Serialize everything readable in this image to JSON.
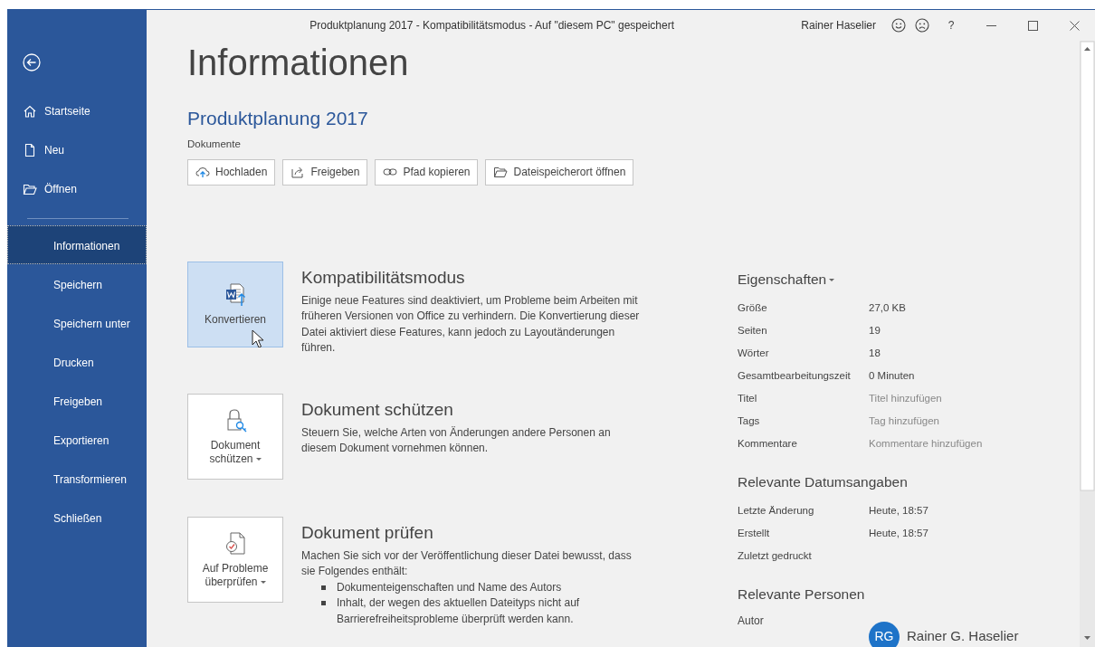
{
  "window": {
    "title": "Produktplanung 2017  -  Kompatibilitätsmodus  -  Auf \"diesem PC\" gespeichert",
    "user": "Rainer Haselier",
    "help": "?"
  },
  "sidebar": {
    "primary_items": [
      {
        "label": "Startseite",
        "selected": false
      },
      {
        "label": "Neu",
        "selected": false
      },
      {
        "label": "Öffnen",
        "selected": false
      }
    ],
    "items": [
      {
        "label": "Informationen",
        "selected": true
      },
      {
        "label": "Speichern",
        "selected": false
      },
      {
        "label": "Speichern unter",
        "selected": false
      },
      {
        "label": "Drucken",
        "selected": false
      },
      {
        "label": "Freigeben",
        "selected": false
      },
      {
        "label": "Exportieren",
        "selected": false
      },
      {
        "label": "Transformieren",
        "selected": false
      },
      {
        "label": "Schließen",
        "selected": false
      }
    ]
  },
  "page": {
    "heading": "Informationen",
    "document": "Produktplanung 2017",
    "location": "Dokumente",
    "actions": [
      "Hochladen",
      "Freigeben",
      "Pfad kopieren",
      "Dateispeicherort öffnen"
    ],
    "sections": [
      {
        "button": "Konvertieren",
        "dropdown": false,
        "selected": true,
        "heading": "Kompatibilitätsmodus",
        "text": "Einige neue Features sind deaktiviert, um Probleme beim Arbeiten mit früheren Versionen von Office zu verhindern. Die Konvertierung dieser Datei aktiviert diese Features, kann jedoch zu Layoutänderungen führen."
      },
      {
        "button": "Dokument schützen",
        "dropdown": true,
        "selected": false,
        "heading": "Dokument schützen",
        "text": "Steuern Sie, welche Arten von Änderungen andere Personen an diesem Dokument vornehmen können."
      },
      {
        "button": "Auf Probleme überprüfen",
        "dropdown": true,
        "selected": false,
        "heading": "Dokument prüfen",
        "text": "Machen Sie sich vor der Veröffentlichung dieser Datei bewusst, dass sie Folgendes enthält:",
        "bullets": [
          "Dokumenteigenschaften und Name des Autors",
          "Inhalt, der wegen des aktuellen Dateityps nicht auf Barrierefreiheitsprobleme überprüft werden kann."
        ]
      }
    ]
  },
  "properties": {
    "heading": "Eigenschaften",
    "rows": [
      {
        "label": "Größe",
        "value": "27,0 KB"
      },
      {
        "label": "Seiten",
        "value": "19"
      },
      {
        "label": "Wörter",
        "value": "18"
      },
      {
        "label": "Gesamtbearbeitungszeit",
        "value": "0 Minuten"
      },
      {
        "label": "Titel",
        "placeholder": "Titel hinzufügen"
      },
      {
        "label": "Tags",
        "placeholder": "Tag hinzufügen"
      },
      {
        "label": "Kommentare",
        "placeholder": "Kommentare hinzufügen"
      }
    ]
  },
  "dates": {
    "heading": "Relevante Datumsangaben",
    "rows": [
      {
        "label": "Letzte Änderung",
        "value": "Heute, 18:57"
      },
      {
        "label": "Erstellt",
        "value": "Heute, 18:57"
      },
      {
        "label": "Zuletzt gedruckt"
      }
    ]
  },
  "people": {
    "heading": "Relevante Personen",
    "rows": [
      {
        "label": "Autor",
        "initials": "RG",
        "name": "Rainer G. Haselier"
      }
    ]
  }
}
